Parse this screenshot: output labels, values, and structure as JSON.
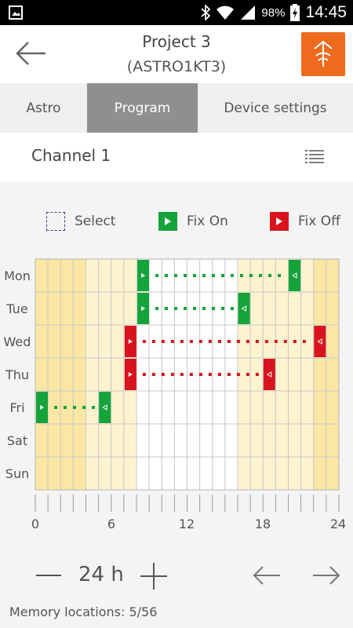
{
  "status_bar": {
    "battery": "98%",
    "time": "14:45"
  },
  "header": {
    "title": "Project 3",
    "subtitle": "(ASTRO1KT3)"
  },
  "tabs": [
    {
      "label": "Astro",
      "active": false
    },
    {
      "label": "Program",
      "active": true
    },
    {
      "label": "Device settings",
      "active": false
    }
  ],
  "channel": {
    "label": "Channel 1"
  },
  "legend": {
    "select": "Select",
    "fix_on": "Fix On",
    "fix_off": "Fix Off"
  },
  "schedule": {
    "days": [
      "Mon",
      "Tue",
      "Wed",
      "Thu",
      "Fri",
      "Sat",
      "Sun"
    ],
    "hour_ticks": [
      "0",
      "6",
      "12",
      "18",
      "24"
    ],
    "night_end_hour": 8,
    "day_end_hours": [
      16,
      16,
      16,
      16,
      16,
      16,
      16
    ],
    "entries": [
      {
        "day": "Mon",
        "type": "fix_on",
        "start": 8,
        "end": 20.5
      },
      {
        "day": "Tue",
        "type": "fix_on",
        "start": 8,
        "end": 16.5
      },
      {
        "day": "Wed",
        "type": "fix_off",
        "start": 7,
        "end": 22.5
      },
      {
        "day": "Thu",
        "type": "fix_off",
        "start": 7,
        "end": 18.5
      },
      {
        "day": "Fri",
        "type": "fix_on",
        "start": 0,
        "end": 5.5
      }
    ],
    "colors": {
      "fix_on": "#15a33a",
      "fix_off": "#d8141f",
      "night": "#fbe7a3",
      "twilight": "#fdf4cf",
      "day": "#ffffff"
    }
  },
  "zoom": {
    "label": "24 h"
  },
  "memory": {
    "text": "Memory locations: 5/56"
  }
}
